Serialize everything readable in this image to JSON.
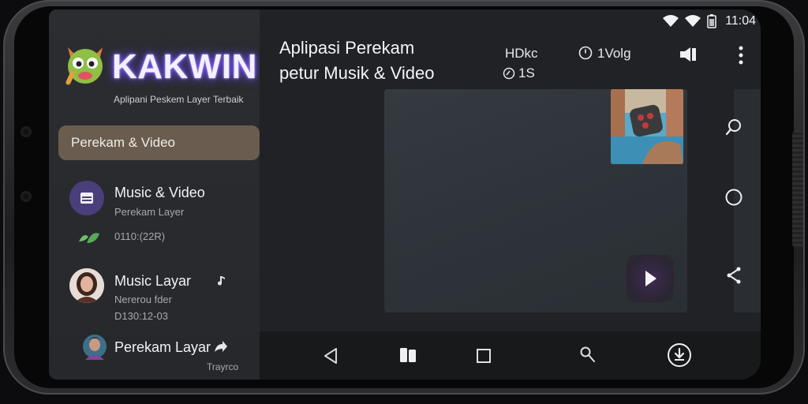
{
  "status_bar": {
    "time": "11:04",
    "icons": [
      "wifi-icon",
      "signal-icon",
      "battery-icon"
    ]
  },
  "sidebar": {
    "brand": "KAKWIN",
    "tagline": "Aplipani Peskem Layer Terbaik",
    "active_item": {
      "label": "Perekam & Video"
    },
    "items": [
      {
        "title": "Music & Video",
        "subtitle": "Perekam Layer",
        "meta": "0110:(22R)",
        "icon": "menu-icon"
      },
      {
        "title": "Music Layar",
        "subtitle": "Nererou fder",
        "meta": "D130:12-03",
        "icon": "music-note-icon"
      },
      {
        "title": "Perekam Layar",
        "meta": "Trayrco",
        "icon": "share-icon"
      }
    ]
  },
  "header": {
    "title_line1": "Aplipasi Perekam",
    "title_line2": "petur Musik & Video",
    "quality": "HDkc",
    "duration": "1S",
    "volume_label": "1Volg"
  },
  "colors": {
    "accent_active": "#6a5d4f",
    "brand_glow": "#6b44ff",
    "background": "#202225"
  }
}
